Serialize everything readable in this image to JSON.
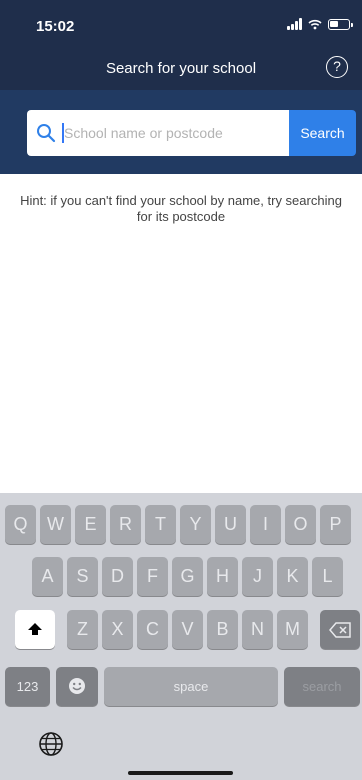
{
  "status_bar": {
    "time": "15:02"
  },
  "header": {
    "title": "Search for your school",
    "help_label": "?"
  },
  "search": {
    "placeholder": "School name or postcode",
    "button_label": "Search"
  },
  "hint": "Hint: if you can't find your school by name, try searching for its postcode",
  "keyboard": {
    "row1": [
      "Q",
      "W",
      "E",
      "R",
      "T",
      "Y",
      "U",
      "I",
      "O",
      "P"
    ],
    "row2": [
      "A",
      "S",
      "D",
      "F",
      "G",
      "H",
      "J",
      "K",
      "L"
    ],
    "row3": [
      "Z",
      "X",
      "C",
      "V",
      "B",
      "N",
      "M"
    ],
    "numbers_label": "123",
    "space_label": "space",
    "search_label": "search",
    "icons": {
      "shift": "shift-icon",
      "backspace": "backspace-icon",
      "emoji": "emoji-icon",
      "globe": "globe-icon"
    }
  },
  "colors": {
    "header": "#1f2e4b",
    "search_band": "#213a62",
    "accent": "#2f80e8"
  }
}
